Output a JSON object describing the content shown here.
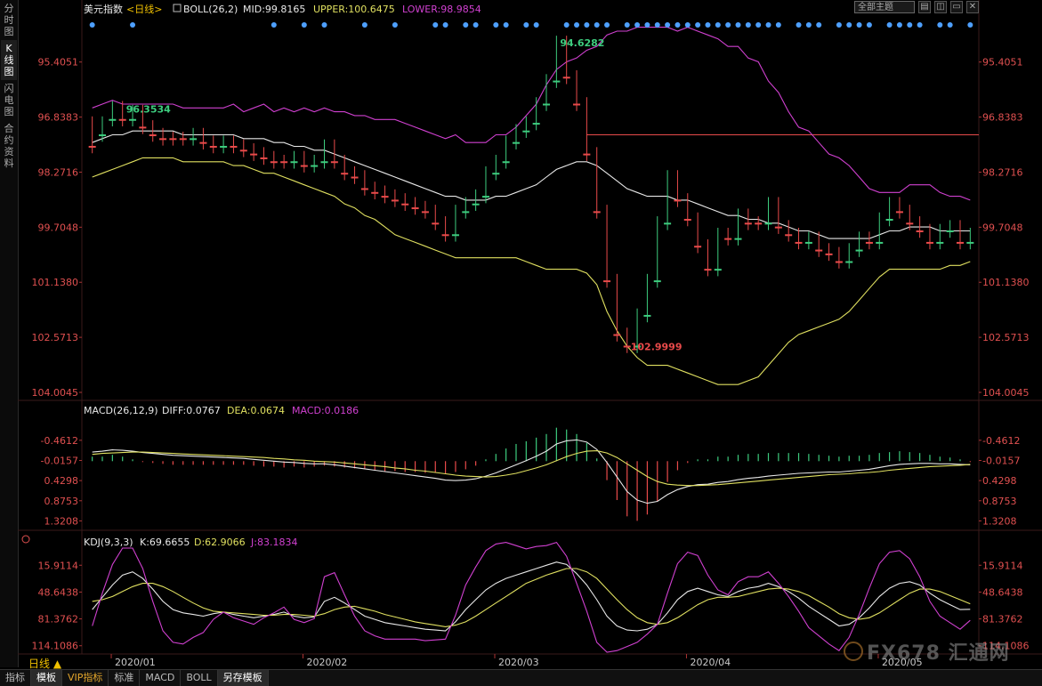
{
  "sidebar": {
    "tabs": [
      {
        "label": "分时图",
        "active": false
      },
      {
        "label": "K线图",
        "active": true
      },
      {
        "label": "闪电图",
        "active": false
      },
      {
        "label": "合约资料",
        "active": false
      }
    ]
  },
  "header": {
    "symbol": "美元指数",
    "period_tag": "<日线>",
    "boll_label": "BOLL(26,2)",
    "mid_label": "MID:99.8165",
    "upper_label": "UPPER:100.6475",
    "lower_label": "LOWER:98.9854",
    "theme_select": "全部主题",
    "window_buttons": [
      "▤",
      "◫",
      "▭",
      "✕"
    ]
  },
  "macd_header": {
    "name": "MACD(26,12,9)",
    "diff": "DIFF:0.0767",
    "dea": "DEA:0.0674",
    "macd": "MACD:0.0186"
  },
  "kdj_header": {
    "name": "KDJ(9,3,3)",
    "k": "K:69.6655",
    "d": "D:62.9066",
    "j": "J:83.1834"
  },
  "bottom_tabs": [
    {
      "label": "指标",
      "active": false,
      "vip": false
    },
    {
      "label": "模板",
      "active": true,
      "vip": false
    },
    {
      "label": "VIP指标",
      "active": false,
      "vip": true
    },
    {
      "label": "标准",
      "active": false,
      "vip": false
    },
    {
      "label": "MACD",
      "active": false,
      "vip": false
    },
    {
      "label": "BOLL",
      "active": false,
      "vip": false
    },
    {
      "label": "另存模板",
      "active": true,
      "vip": false
    }
  ],
  "period_button": "日线 ▲",
  "watermark": "FX678 汇通网",
  "colors": {
    "up": "#e84a4a",
    "down": "#3dcc7e",
    "mid": "#e8e8e8",
    "upper": "#e0e060",
    "lower": "#d040d0",
    "axis_text": "#e05050",
    "label_blue": "#4ea0ff"
  },
  "chart_data": [
    {
      "type": "candlestick",
      "title": "美元指数 日线",
      "y_axis_ticks": [
        104.0045,
        102.5713,
        101.138,
        99.7048,
        98.2716,
        96.8383,
        95.4051
      ],
      "ylim": [
        94.3,
        104.0045
      ],
      "x_tick_labels": [
        "2020/01",
        "2020/02",
        "2020/03",
        "2020/04",
        "2020/05"
      ],
      "annotations": [
        {
          "text": "102.9999",
          "type": "high"
        },
        {
          "text": "96.3534",
          "type": "low"
        },
        {
          "text": "94.6282",
          "type": "low"
        }
      ],
      "horizontal_line": 97.3,
      "highlight_box": {
        "y_top": 100.9,
        "y_bottom": 98.75
      },
      "close": [
        97.6,
        97.0,
        96.6,
        96.9,
        96.7,
        97.1,
        97.3,
        97.4,
        97.4,
        97.4,
        97.3,
        97.5,
        97.6,
        97.5,
        97.6,
        97.7,
        97.8,
        97.9,
        98.0,
        98.0,
        97.9,
        98.1,
        98.0,
        97.6,
        98.0,
        98.3,
        98.4,
        98.7,
        98.8,
        98.9,
        99.0,
        99.1,
        99.2,
        99.3,
        99.6,
        99.9,
        99.3,
        99.1,
        98.9,
        98.3,
        98.0,
        97.5,
        97.2,
        97.0,
        96.5,
        95.9,
        94.9,
        95.8,
        96.5,
        97.8,
        99.3,
        101.1,
        102.5,
        102.8,
        102.0,
        101.1,
        99.6,
        98.4,
        99.0,
        99.5,
        100.2,
        100.8,
        99.9,
        100.0,
        99.4,
        99.6,
        99.6,
        99.1,
        99.7,
        99.9,
        100.1,
        100.0,
        100.3,
        100.4,
        100.6,
        100.3,
        100.0,
        100.1,
        99.5,
        99.1,
        99.3,
        99.6,
        99.8,
        100.1,
        99.8,
        99.7,
        100.1,
        99.9
      ],
      "open": [
        97.0,
        97.3,
        96.9,
        96.6,
        96.9,
        96.7,
        97.1,
        97.3,
        97.4,
        97.4,
        97.4,
        97.3,
        97.5,
        97.6,
        97.5,
        97.6,
        97.7,
        97.8,
        97.9,
        98.0,
        98.0,
        97.9,
        98.1,
        98.0,
        97.6,
        98.0,
        98.3,
        98.4,
        98.7,
        98.8,
        98.9,
        99.0,
        99.1,
        99.2,
        99.3,
        99.6,
        99.9,
        99.3,
        99.1,
        98.9,
        98.3,
        98.0,
        97.5,
        97.2,
        97.0,
        96.5,
        95.9,
        94.9,
        95.8,
        96.5,
        97.8,
        99.3,
        101.1,
        102.5,
        102.8,
        102.0,
        101.1,
        99.6,
        98.4,
        99.0,
        99.5,
        100.2,
        100.8,
        99.9,
        100.0,
        99.4,
        99.6,
        99.6,
        99.1,
        99.7,
        99.9,
        100.1,
        100.0,
        100.3,
        100.4,
        100.6,
        100.3,
        100.0,
        100.1,
        99.5,
        99.1,
        99.3,
        99.6,
        99.8,
        100.1,
        99.8,
        99.7,
        100.1
      ],
      "series": [
        {
          "name": "MID",
          "values": [
            97.5,
            97.4,
            97.3,
            97.3,
            97.2,
            97.2,
            97.2,
            97.2,
            97.2,
            97.3,
            97.3,
            97.3,
            97.3,
            97.3,
            97.3,
            97.4,
            97.4,
            97.4,
            97.5,
            97.5,
            97.6,
            97.6,
            97.7,
            97.7,
            97.8,
            97.9,
            98.0,
            98.1,
            98.2,
            98.3,
            98.4,
            98.5,
            98.6,
            98.7,
            98.8,
            98.9,
            98.9,
            99.0,
            99.0,
            99.0,
            98.9,
            98.9,
            98.8,
            98.7,
            98.6,
            98.4,
            98.2,
            98.1,
            98.0,
            98.0,
            98.1,
            98.3,
            98.5,
            98.7,
            98.8,
            98.9,
            98.9,
            98.9,
            99.0,
            99.0,
            99.1,
            99.2,
            99.3,
            99.4,
            99.4,
            99.5,
            99.5,
            99.6,
            99.6,
            99.7,
            99.8,
            99.8,
            99.9,
            100.0,
            100.0,
            100.0,
            100.0,
            100.0,
            99.9,
            99.8,
            99.8,
            99.7,
            99.7,
            99.7,
            99.8,
            99.8,
            99.8,
            99.8
          ]
        },
        {
          "name": "UPPER",
          "values": [
            98.4,
            98.3,
            98.2,
            98.1,
            98.0,
            97.9,
            97.9,
            97.9,
            97.9,
            98.0,
            98.0,
            98.0,
            98.0,
            98.0,
            98.1,
            98.1,
            98.2,
            98.3,
            98.3,
            98.4,
            98.5,
            98.6,
            98.7,
            98.8,
            98.9,
            99.1,
            99.2,
            99.4,
            99.5,
            99.7,
            99.9,
            100.0,
            100.1,
            100.2,
            100.3,
            100.4,
            100.5,
            100.5,
            100.5,
            100.5,
            100.5,
            100.5,
            100.5,
            100.6,
            100.7,
            100.8,
            100.8,
            100.8,
            100.8,
            100.9,
            101.2,
            101.9,
            102.4,
            102.8,
            103.1,
            103.3,
            103.3,
            103.3,
            103.4,
            103.5,
            103.6,
            103.7,
            103.8,
            103.8,
            103.8,
            103.7,
            103.6,
            103.3,
            103.0,
            102.7,
            102.5,
            102.4,
            102.3,
            102.2,
            102.1,
            101.9,
            101.6,
            101.3,
            101.0,
            100.8,
            100.8,
            100.8,
            100.8,
            100.8,
            100.8,
            100.7,
            100.7,
            100.6
          ]
        },
        {
          "name": "LOWER",
          "values": [
            96.6,
            96.5,
            96.4,
            96.5,
            96.5,
            96.5,
            96.5,
            96.5,
            96.5,
            96.6,
            96.6,
            96.6,
            96.6,
            96.6,
            96.5,
            96.7,
            96.6,
            96.5,
            96.7,
            96.6,
            96.7,
            96.6,
            96.7,
            96.6,
            96.7,
            96.7,
            96.8,
            96.8,
            96.9,
            96.9,
            96.9,
            97.0,
            97.1,
            97.2,
            97.3,
            97.4,
            97.3,
            97.5,
            97.5,
            97.5,
            97.3,
            97.3,
            97.1,
            96.8,
            96.5,
            96.0,
            95.6,
            95.4,
            95.3,
            95.1,
            95.0,
            94.7,
            94.6,
            94.6,
            94.5,
            94.5,
            94.5,
            94.5,
            94.6,
            94.5,
            94.6,
            94.7,
            94.8,
            95.0,
            95.0,
            95.3,
            95.4,
            95.9,
            96.2,
            96.7,
            97.1,
            97.2,
            97.5,
            97.8,
            97.9,
            98.1,
            98.4,
            98.7,
            98.8,
            98.8,
            98.8,
            98.6,
            98.6,
            98.6,
            98.8,
            98.9,
            98.9,
            99.0
          ]
        }
      ]
    },
    {
      "type": "bar",
      "title": "MACD(26,12,9)",
      "y_axis_ticks": [
        1.3208,
        0.8753,
        0.4298,
        -0.0157,
        -0.4612
      ],
      "ylim": [
        -0.95,
        1.45
      ],
      "series": [
        {
          "name": "DIFF",
          "values": [
            -0.2,
            -0.22,
            -0.25,
            -0.24,
            -0.22,
            -0.19,
            -0.17,
            -0.15,
            -0.13,
            -0.12,
            -0.11,
            -0.1,
            -0.09,
            -0.08,
            -0.07,
            -0.06,
            -0.04,
            -0.02,
            0.0,
            0.02,
            0.03,
            0.05,
            0.06,
            0.06,
            0.08,
            0.11,
            0.14,
            0.17,
            0.2,
            0.23,
            0.26,
            0.29,
            0.32,
            0.35,
            0.38,
            0.42,
            0.43,
            0.42,
            0.39,
            0.33,
            0.26,
            0.17,
            0.08,
            -0.01,
            -0.11,
            -0.22,
            -0.38,
            -0.45,
            -0.47,
            -0.42,
            -0.26,
            0.03,
            0.35,
            0.67,
            0.86,
            0.93,
            0.89,
            0.74,
            0.63,
            0.56,
            0.52,
            0.51,
            0.47,
            0.45,
            0.41,
            0.38,
            0.36,
            0.33,
            0.31,
            0.29,
            0.27,
            0.26,
            0.25,
            0.24,
            0.24,
            0.22,
            0.2,
            0.18,
            0.14,
            0.1,
            0.07,
            0.06,
            0.05,
            0.05,
            0.06,
            0.06,
            0.07,
            0.08
          ]
        },
        {
          "name": "DEA",
          "values": [
            -0.15,
            -0.17,
            -0.18,
            -0.19,
            -0.2,
            -0.2,
            -0.19,
            -0.18,
            -0.17,
            -0.16,
            -0.15,
            -0.14,
            -0.13,
            -0.12,
            -0.11,
            -0.1,
            -0.09,
            -0.08,
            -0.06,
            -0.05,
            -0.03,
            -0.02,
            -0.0,
            0.01,
            0.02,
            0.04,
            0.06,
            0.08,
            0.1,
            0.12,
            0.15,
            0.17,
            0.2,
            0.22,
            0.25,
            0.28,
            0.31,
            0.33,
            0.34,
            0.35,
            0.34,
            0.31,
            0.27,
            0.21,
            0.15,
            0.08,
            -0.01,
            -0.1,
            -0.17,
            -0.22,
            -0.23,
            -0.18,
            -0.08,
            0.06,
            0.2,
            0.34,
            0.45,
            0.51,
            0.53,
            0.54,
            0.54,
            0.53,
            0.52,
            0.5,
            0.48,
            0.46,
            0.44,
            0.42,
            0.4,
            0.38,
            0.36,
            0.34,
            0.32,
            0.3,
            0.29,
            0.28,
            0.26,
            0.25,
            0.23,
            0.2,
            0.18,
            0.16,
            0.14,
            0.12,
            0.11,
            0.1,
            0.09,
            0.07
          ]
        }
      ]
    },
    {
      "type": "line",
      "title": "KDJ(9,3,3)",
      "y_axis_ticks": [
        114.1086,
        81.3762,
        48.6438,
        15.9114
      ],
      "ylim": [
        -5,
        122
      ],
      "series": [
        {
          "name": "K",
          "values": [
            70,
            55,
            40,
            28,
            24,
            32,
            45,
            60,
            70,
            74,
            76,
            78,
            75,
            73,
            76,
            78,
            80,
            78,
            76,
            73,
            78,
            80,
            79,
            60,
            55,
            62,
            70,
            78,
            82,
            86,
            88,
            90,
            92,
            94,
            95,
            96,
            85,
            70,
            58,
            46,
            38,
            32,
            28,
            24,
            20,
            16,
            12,
            15,
            26,
            40,
            58,
            78,
            90,
            95,
            96,
            94,
            88,
            74,
            58,
            48,
            44,
            48,
            52,
            54,
            48,
            44,
            42,
            38,
            42,
            48,
            56,
            66,
            74,
            82,
            90,
            88,
            80,
            68,
            54,
            44,
            38,
            36,
            40,
            50,
            58,
            64,
            70,
            69.67
          ]
        },
        {
          "name": "D",
          "values": [
            60,
            58,
            54,
            48,
            42,
            38,
            38,
            42,
            48,
            55,
            62,
            68,
            72,
            73,
            74,
            75,
            76,
            77,
            77,
            76,
            76,
            77,
            78,
            75,
            70,
            67,
            66,
            69,
            72,
            76,
            79,
            82,
            85,
            87,
            89,
            91,
            89,
            85,
            78,
            70,
            62,
            54,
            46,
            38,
            33,
            28,
            24,
            20,
            20,
            24,
            32,
            45,
            58,
            70,
            80,
            86,
            88,
            86,
            80,
            72,
            64,
            58,
            55,
            55,
            54,
            51,
            48,
            45,
            44,
            45,
            48,
            53,
            60,
            67,
            75,
            80,
            82,
            80,
            74,
            66,
            58,
            50,
            45,
            45,
            48,
            53,
            58,
            62.9
          ]
        },
        {
          "name": "J",
          "values": [
            90,
            50,
            15,
            -5,
            -5,
            20,
            60,
            96,
            110,
            112,
            104,
            98,
            82,
            73,
            80,
            84,
            88,
            80,
            74,
            67,
            82,
            86,
            81,
            30,
            25,
            52,
            78,
            96,
            102,
            106,
            106,
            106,
            106,
            108,
            107,
            106,
            77,
            40,
            18,
            -2,
            -10,
            -12,
            -8,
            -4,
            -7,
            -8,
            -12,
            5,
            38,
            72,
            110,
            122,
            120,
            115,
            110,
            100,
            88,
            50,
            14,
            0,
            4,
            28,
            46,
            52,
            36,
            30,
            30,
            24,
            38,
            54,
            72,
            92,
            102,
            112,
            120,
            104,
            76,
            44,
            14,
            0,
            -2,
            8,
            30,
            60,
            78,
            86,
            94,
            83.18
          ]
        }
      ]
    }
  ]
}
